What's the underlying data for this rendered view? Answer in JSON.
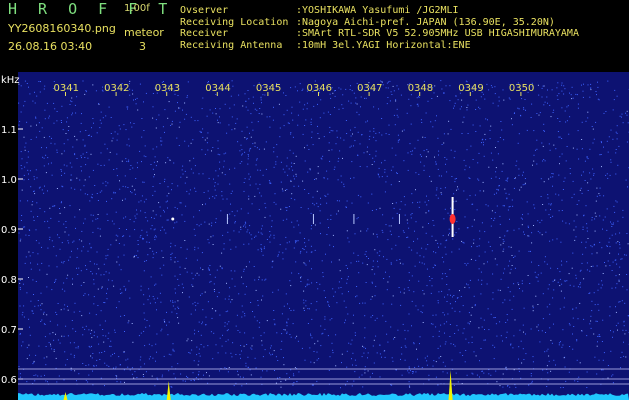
{
  "header": {
    "app_title": "H R O F F T",
    "version": "1.00f",
    "filename": "YY2608160340.png",
    "datetime": "26.08.16 03:40",
    "meteor_label": "meteor",
    "meteor_count": "3",
    "info": [
      {
        "key": "Ovserver",
        "value": ":YOSHIKAWA Yasufumi /JG2MLI"
      },
      {
        "key": "Receiving Location",
        "value": ":Nagoya Aichi-pref. JAPAN (136.90E, 35.20N)"
      },
      {
        "key": "Receiver",
        "value": ":SMArt RTL-SDR V5 52.905MHz USB HIGASHIMURAYAMA"
      },
      {
        "key": "Receiving Antenna",
        "value": ":10mH 3el.YAGI Horizontal:ENE"
      }
    ]
  },
  "colors": {
    "background": "#0d1272",
    "noise": "#3e62ff",
    "text_yellow": "#e8e060",
    "title_green": "#7fe07f",
    "echo_red": "#ff3030",
    "baseline_cyan": "#20c8ff",
    "spike_yellow": "#f2f200"
  },
  "chart_data": {
    "type": "heatmap",
    "y_unit_label": "kHz",
    "x_ticks": [
      "0341",
      "0342",
      "0343",
      "0344",
      "0345",
      "0346",
      "0347",
      "0348",
      "0349",
      "0350"
    ],
    "y_ticks": [
      "1.1",
      "1.0",
      "0.9",
      "0.8",
      "0.7",
      "0.6"
    ],
    "y_tick_values": [
      1.1,
      1.0,
      0.9,
      0.8,
      0.7,
      0.6
    ],
    "ylim": [
      0.58,
      1.16
    ],
    "xlim": [
      40.65,
      50.65
    ],
    "reference_lines_khz": [
      0.62,
      0.6,
      0.59
    ],
    "echoes": [
      {
        "minute": 48.65,
        "freq_khz": 0.92,
        "strength": "strong"
      },
      {
        "minute": 43.12,
        "freq_khz": 0.92,
        "strength": "weak"
      }
    ],
    "amplitude_spikes_minute": [
      43.04,
      48.61,
      41.0
    ]
  }
}
